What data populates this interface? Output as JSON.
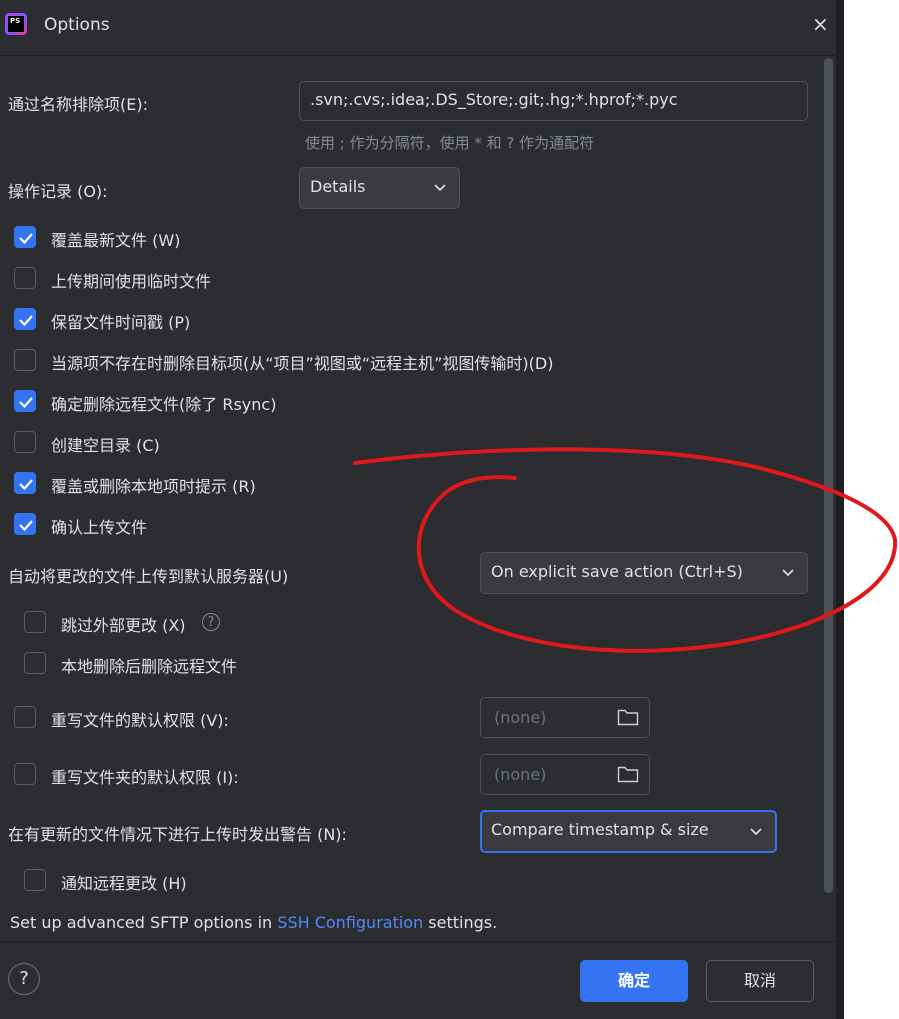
{
  "window": {
    "title": "Options",
    "app_icon_text": "PS",
    "close_glyph": "×"
  },
  "exclude": {
    "label": "通过名称排除项(E):",
    "value": ".svn;.cvs;.idea;.DS_Store;.git;.hg;*.hprof;*.pyc",
    "hint": "使用 ; 作为分隔符，使用 * 和 ? 作为通配符"
  },
  "operations": {
    "label": "操作记录 (O):",
    "value": "Details"
  },
  "checkboxes": [
    {
      "label": "覆盖最新文件 (W)",
      "checked": true
    },
    {
      "label": "上传期间使用临时文件",
      "checked": false
    },
    {
      "label": "保留文件时间戳 (P)",
      "checked": true
    },
    {
      "label": "当源项不存在时删除目标项(从“项目”视图或“远程主机”视图传输时)(D)",
      "checked": false
    },
    {
      "label": "确定删除远程文件(除了 Rsync)",
      "checked": true
    },
    {
      "label": "创建空目录 (C)",
      "checked": false
    },
    {
      "label": "覆盖或删除本地项时提示 (R)",
      "checked": true
    },
    {
      "label": "确认上传文件",
      "checked": true
    }
  ],
  "auto_upload": {
    "label": "自动将更改的文件上传到默认服务器(U)",
    "value": "On explicit save action (Ctrl+S)"
  },
  "sub_checkboxes": [
    {
      "label": "跳过外部更改 (X)",
      "checked": false,
      "help": "?"
    },
    {
      "label": "本地删除后删除远程文件",
      "checked": false
    }
  ],
  "permissions": [
    {
      "label": "重写文件的默认权限 (V):",
      "checked": false,
      "placeholder": "(none)"
    },
    {
      "label": "重写文件夹的默认权限 (I):",
      "checked": false,
      "placeholder": "(none)"
    }
  ],
  "warn_upload": {
    "label": "在有更新的文件情况下进行上传时发出警告 (N):",
    "value": "Compare timestamp & size"
  },
  "notify": {
    "label": "通知远程更改 (H)",
    "checked": false
  },
  "sftp": {
    "prefix": "Set up advanced SFTP options in ",
    "link": "SSH Configuration",
    "suffix": " settings."
  },
  "footer": {
    "help": "?",
    "ok": "确定",
    "cancel": "取消"
  },
  "colors": {
    "accent": "#3574f0",
    "link": "#548af7",
    "background": "#2b2d30",
    "annotation": "#e0191d"
  }
}
